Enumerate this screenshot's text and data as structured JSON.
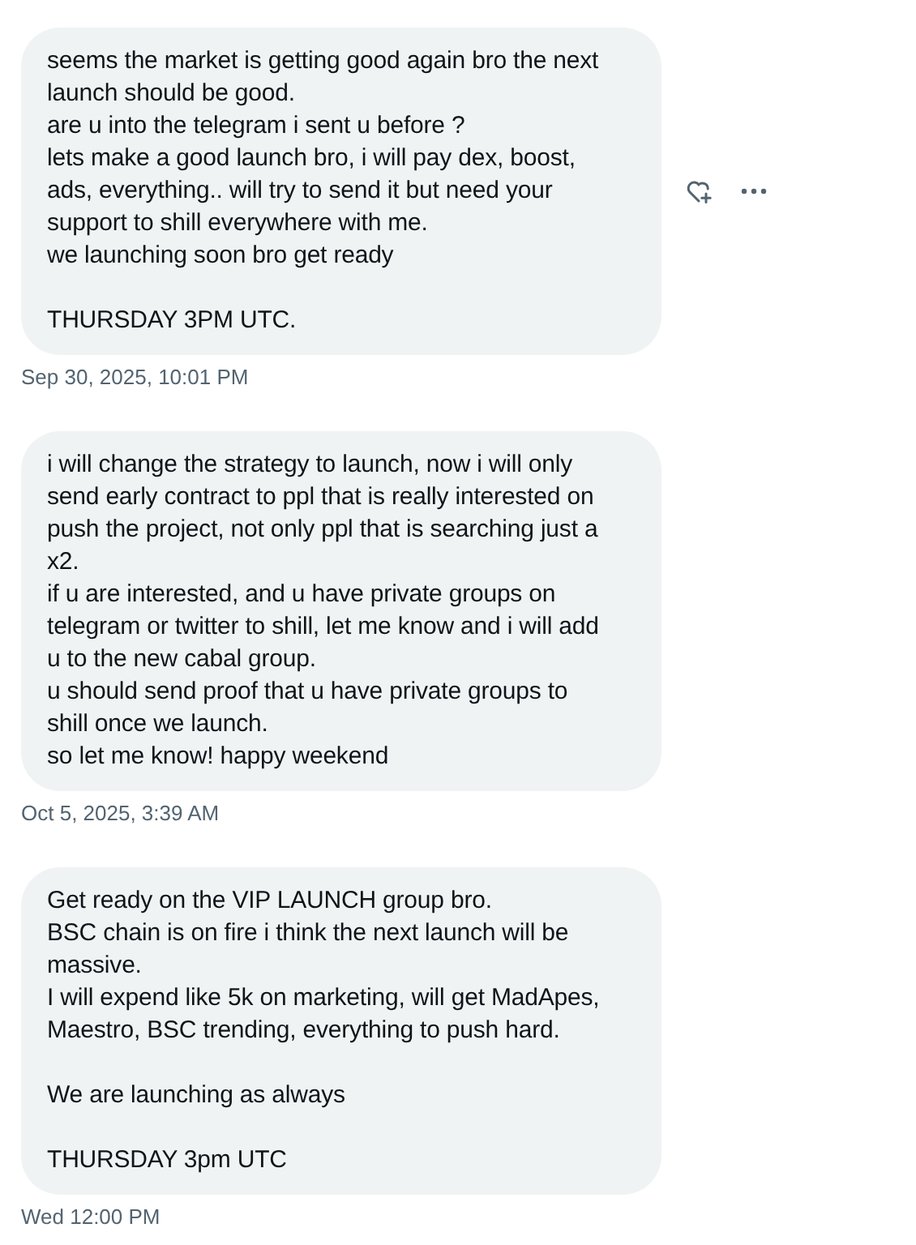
{
  "messages": [
    {
      "paragraphs": [
        [
          "seems the market is getting good again bro the next",
          "launch should be good.",
          "are u into the telegram i sent u before ?",
          "lets make a good launch bro, i will pay dex, boost,",
          "ads, everything.. will try to send it but need your",
          "support to shill everywhere with me.",
          "we launching soon bro get ready"
        ],
        [
          "THURSDAY  3PM UTC."
        ]
      ],
      "timestamp": "Sep 30, 2025, 10:01 PM",
      "show_actions": true
    },
    {
      "paragraphs": [
        [
          "i will change the strategy to launch, now i will only",
          "send early contract to ppl that is really interested on",
          "push the project, not only ppl that is searching just a",
          "x2.",
          "if u are interested, and u have private groups on",
          "telegram or twitter to shill, let me know and i will add",
          "u to the new cabal group.",
          "u should send proof that u have private groups to",
          "shill once we launch.",
          "so let me know! happy weekend"
        ]
      ],
      "timestamp": "Oct 5, 2025, 3:39 AM",
      "show_actions": false
    },
    {
      "paragraphs": [
        [
          "Get ready on the VIP LAUNCH group bro.",
          "BSC chain is on fire i think the next launch will be",
          "massive.",
          "I will expend like 5k on marketing, will get MadApes,",
          "Maestro, BSC trending, everything to push hard."
        ],
        [
          "We are launching as always"
        ],
        [
          "THURSDAY 3pm UTC"
        ]
      ],
      "timestamp": "Wed 12:00 PM",
      "show_actions": false
    }
  ]
}
